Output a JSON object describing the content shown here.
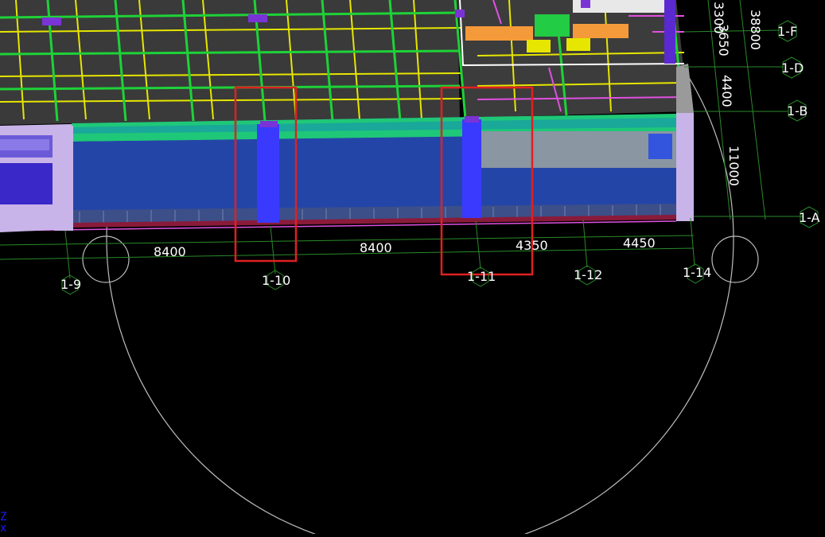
{
  "colors": {
    "background": "#000000",
    "wall_blue": "#2445a8",
    "column_blue": "#3a3aff",
    "slab_green": "#1ed238",
    "teal": "#19a89a",
    "lavender": "#c8b4e8",
    "grid_line": "#2a8a2a",
    "highlight_red": "#e02020",
    "beam_yellow": "#e6e600",
    "magenta": "#e050e0",
    "orange": "#f59a3a"
  },
  "dimensions_horizontal": [
    "8400",
    "8400",
    "4350",
    "4450"
  ],
  "dimensions_vertical": [
    "3300",
    "3650",
    "38800",
    "4400",
    "11000"
  ],
  "grid_labels_bottom": [
    "1-9",
    "1-10",
    "1-11",
    "1-12",
    "1-14"
  ],
  "grid_labels_right": [
    "1-F",
    "1-D",
    "1-B",
    "1-A"
  ],
  "axis_indicator": {
    "z": "Z",
    "x": "x"
  },
  "selection_boxes": 2
}
